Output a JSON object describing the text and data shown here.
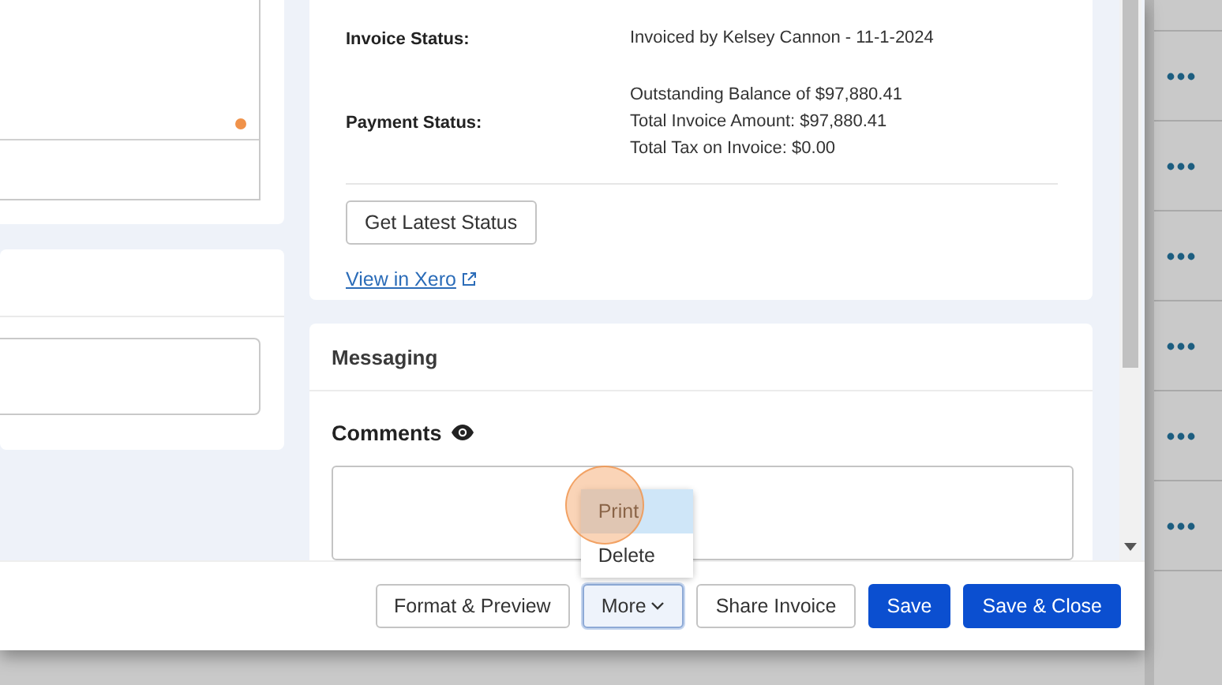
{
  "invoice_panel": {
    "fields": [
      {
        "label": "Invoice Status:",
        "lines": [
          "Invoiced by Kelsey Cannon - 11-1-2024"
        ]
      },
      {
        "label": "Payment Status:",
        "lines": [
          "Outstanding Balance of $97,880.41",
          "Total Invoice Amount: $97,880.41",
          "Total Tax on Invoice: $0.00"
        ]
      }
    ],
    "status_button": "Get Latest Status",
    "link": "View in Xero"
  },
  "messaging": {
    "title": "Messaging",
    "comments_label": "Comments"
  },
  "footer_buttons": [
    {
      "label": "Format & Preview",
      "kind": "default"
    },
    {
      "label": "More",
      "kind": "menu",
      "expanded": true
    },
    {
      "label": "Share Invoice",
      "kind": "default"
    },
    {
      "label": "Save",
      "kind": "primary"
    },
    {
      "label": "Save & Close",
      "kind": "primary"
    }
  ],
  "more_menu": [
    {
      "label": "Print",
      "selected": true
    },
    {
      "label": "Delete",
      "selected": false
    }
  ]
}
